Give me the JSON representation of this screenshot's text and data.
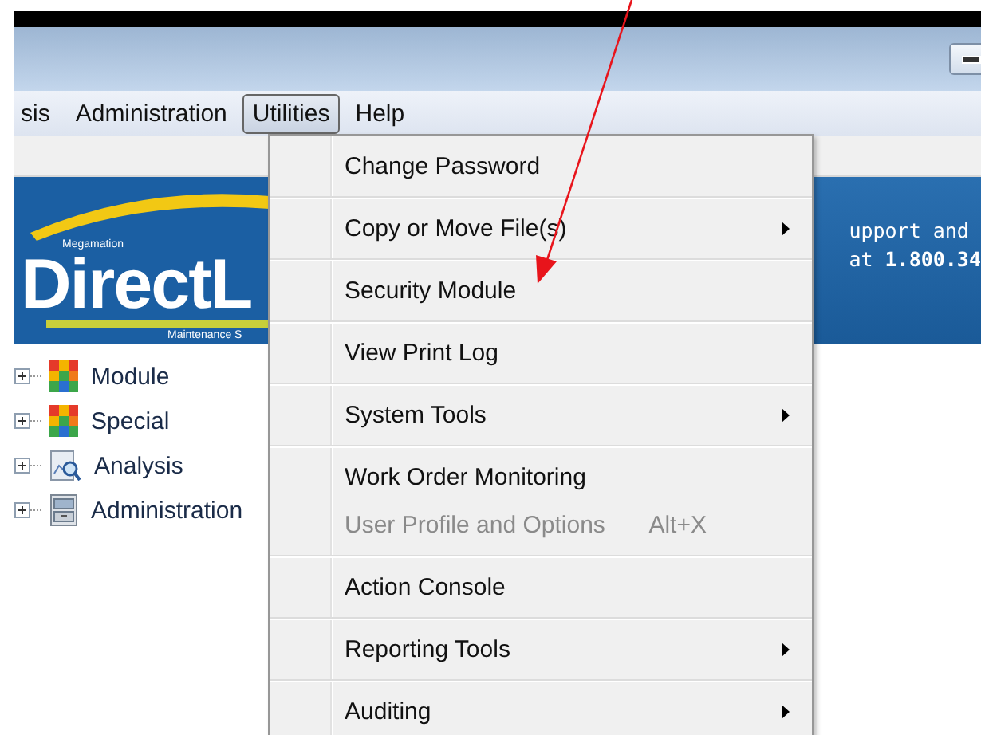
{
  "menubar": [
    {
      "label": "sis",
      "selected": false
    },
    {
      "label": "Administration",
      "selected": false
    },
    {
      "label": "Utilities",
      "selected": true
    },
    {
      "label": "Help",
      "selected": false
    }
  ],
  "banner": {
    "logo_small": "Megamation",
    "logo": "DirectL",
    "logo_tagline": "Maintenance S",
    "support_lines": [
      "upport and",
      "at **1.800.34**"
    ]
  },
  "tree": [
    {
      "label": "Module",
      "kind": "grid",
      "expanded": false
    },
    {
      "label": "Special",
      "kind": "grid",
      "expanded": false
    },
    {
      "label": "Analysis",
      "kind": "report",
      "expanded": false
    },
    {
      "label": "Administration",
      "kind": "cabinet",
      "expanded": false
    }
  ],
  "menu": {
    "groups": [
      [
        {
          "label": "Change Password",
          "submenu": false,
          "disabled": false
        }
      ],
      [
        {
          "label": "Copy or Move File(s)",
          "submenu": true,
          "disabled": false
        }
      ],
      [
        {
          "label": "Security Module",
          "submenu": false,
          "disabled": false
        }
      ],
      [
        {
          "label": "View Print Log",
          "submenu": false,
          "disabled": false
        }
      ],
      [
        {
          "label": "System Tools",
          "submenu": true,
          "disabled": false
        }
      ],
      [
        {
          "label": "Work Order Monitoring",
          "submenu": false,
          "disabled": false
        },
        {
          "label": "User Profile and Options",
          "submenu": false,
          "disabled": true,
          "shortcut": "Alt+X"
        }
      ],
      [
        {
          "label": "Action Console",
          "submenu": false,
          "disabled": false
        }
      ],
      [
        {
          "label": "Reporting Tools",
          "submenu": true,
          "disabled": false
        }
      ],
      [
        {
          "label": "Auditing",
          "submenu": true,
          "disabled": false
        }
      ]
    ]
  }
}
